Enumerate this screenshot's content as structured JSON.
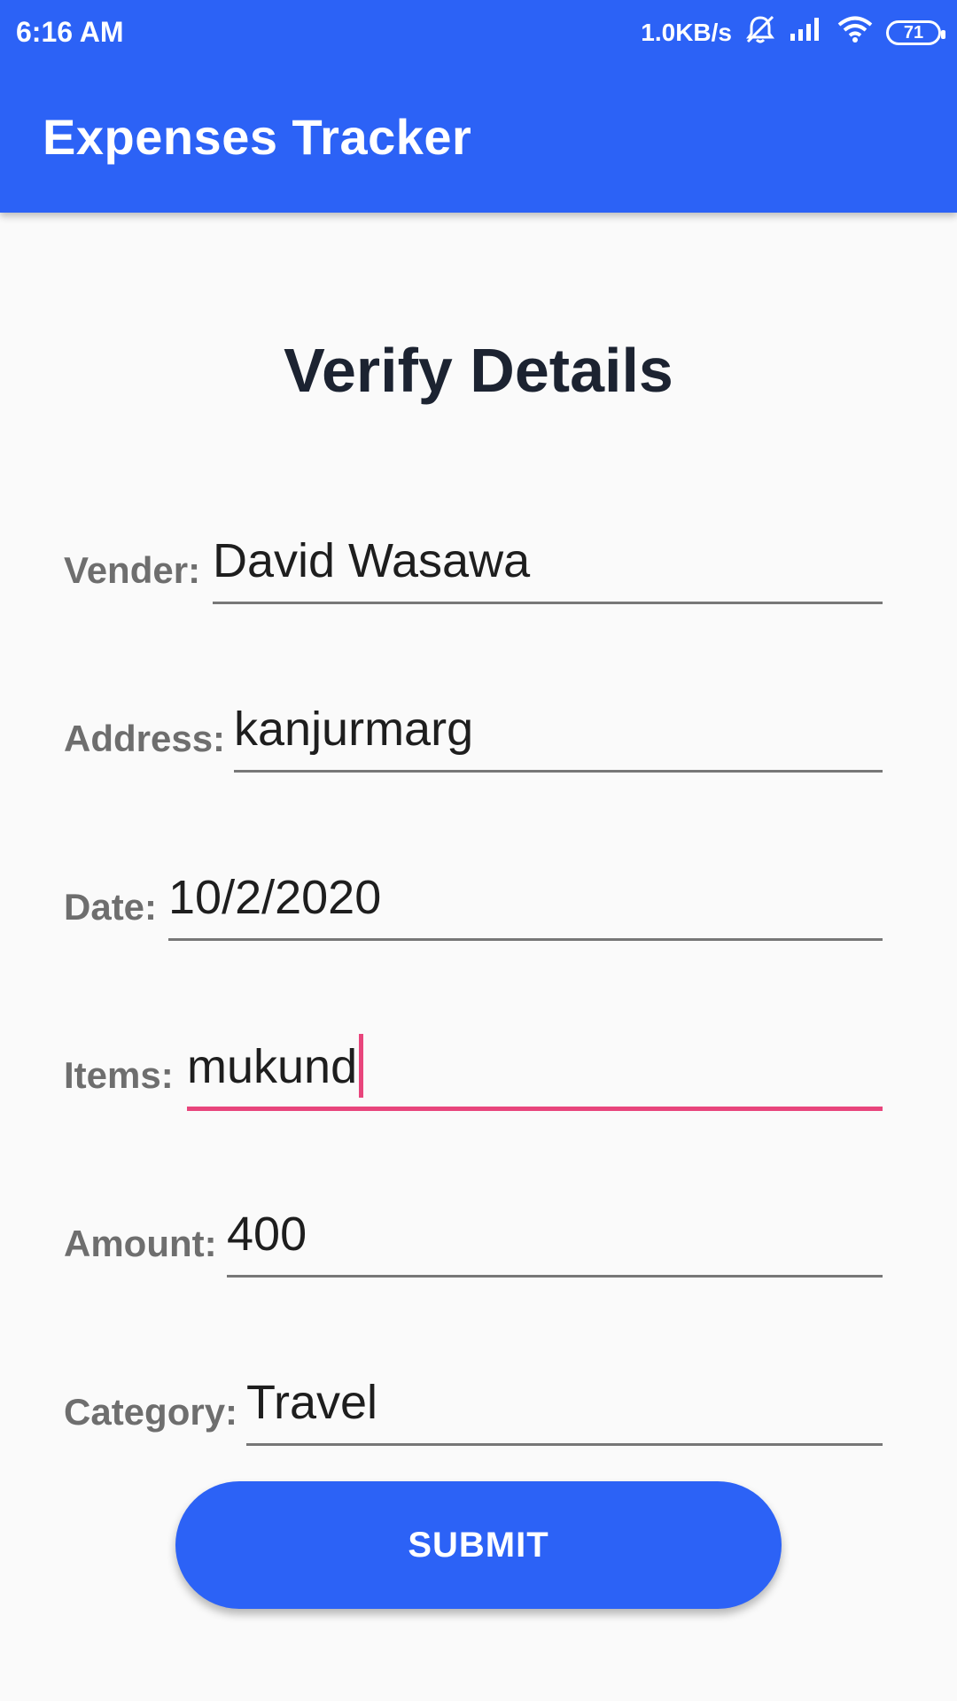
{
  "status_bar": {
    "time": "6:16 AM",
    "network_speed": "1.0KB/s",
    "battery_level": "71",
    "icons": [
      "bell-off-icon",
      "signal-icon",
      "wifi-icon",
      "battery-icon"
    ]
  },
  "app_bar": {
    "title": "Expenses Tracker",
    "color": "#2c62f6"
  },
  "page": {
    "title": "Verify Details"
  },
  "form": {
    "vendor": {
      "label": "Vender:",
      "value": "David Wasawa"
    },
    "address": {
      "label": "Address:",
      "value": "kanjurmarg"
    },
    "date": {
      "label": "Date:",
      "value": "10/2/2020"
    },
    "items": {
      "label": "Items:",
      "value": "mukund",
      "focused": true
    },
    "amount": {
      "label": "Amount:",
      "value": "400"
    },
    "category": {
      "label": "Category:",
      "value": "Travel"
    }
  },
  "submit": {
    "label": "SUBMIT"
  },
  "colors": {
    "accent": "#2c62f6",
    "focus": "#e8457c",
    "label": "#6e6e6e"
  }
}
